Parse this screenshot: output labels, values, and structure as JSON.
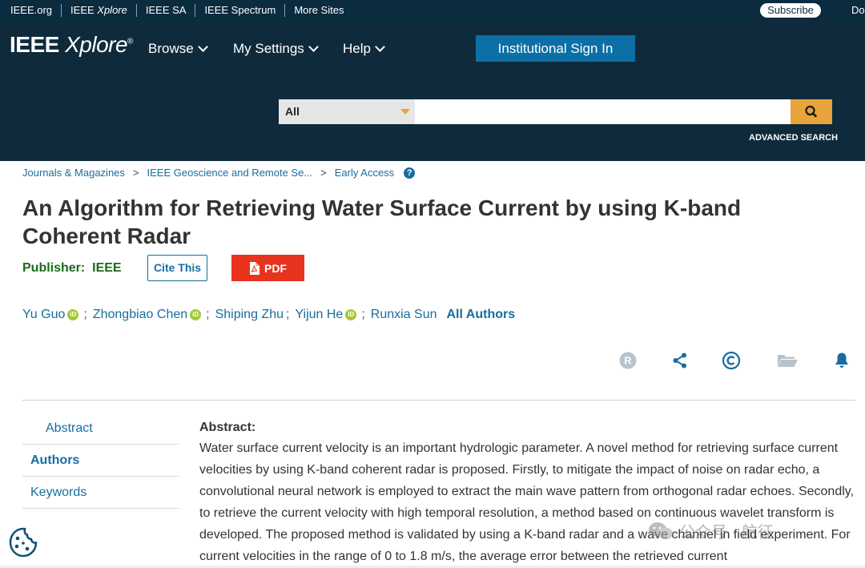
{
  "top_links": {
    "ieee_org": "IEEE.org",
    "xplore_prefix": "IEEE ",
    "xplore_italic": "Xplore",
    "ieee_sa": "IEEE SA",
    "ieee_spectrum": "IEEE Spectrum",
    "more_sites": "More Sites",
    "subscribe": "Subscribe",
    "cut_text": "Do"
  },
  "header": {
    "logo_main": "IEEE ",
    "logo_italic": "Xplore",
    "logo_reg": "®",
    "nav": [
      "Browse",
      "My Settings",
      "Help"
    ],
    "signin": "Institutional Sign In",
    "search_scope": "All",
    "search_placeholder": "",
    "advanced_search": "ADVANCED SEARCH"
  },
  "breadcrumb": [
    "Journals & Magazines",
    "IEEE Geoscience and Remote Se...",
    "Early Access"
  ],
  "article": {
    "title": "An Algorithm for Retrieving Water Surface Current by using K-band Coherent Radar",
    "publisher_label": "Publisher:",
    "publisher_value": "IEEE",
    "cite_this": "Cite This",
    "pdf": "PDF",
    "authors": [
      "Yu Guo",
      "Zhongbiao Chen",
      "Shiping Zhu",
      "Yijun He",
      "Runxia Sun"
    ],
    "authors_orcid": [
      true,
      true,
      false,
      true,
      false
    ],
    "all_authors": "All Authors"
  },
  "action_icons": [
    "rights-icon",
    "share-icon",
    "copyright-icon",
    "folder-icon",
    "bell-icon"
  ],
  "sidenav": [
    "Abstract",
    "Authors",
    "Keywords"
  ],
  "abstract": {
    "heading": "Abstract:",
    "text": "Water surface current velocity is an important hydrologic parameter. A novel method for retrieving surface current velocities by using K-band coherent radar is proposed. Firstly, to mitigate the impact of noise on radar echo, a convolutional neural network is employed to extract the main wave pattern from orthogonal radar echoes. Secondly, to retrieve the current velocity with high temporal resolution, a method based on continuous wavelet transform is developed. The proposed method is validated by using a K-band radar and a wave channel in field experiment. For current velocities in the range of 0 to 1.8 m/s, the average error between the retrieved current"
  },
  "watermark": "公众号 · 航征",
  "colors": {
    "header_bg": "#0f2b3b",
    "link_blue": "#176e9e",
    "signin_blue": "#0c6fa6",
    "search_orange": "#e8a33a",
    "pdf_red": "#e8331f",
    "publisher_green": "#1a6b1a"
  }
}
